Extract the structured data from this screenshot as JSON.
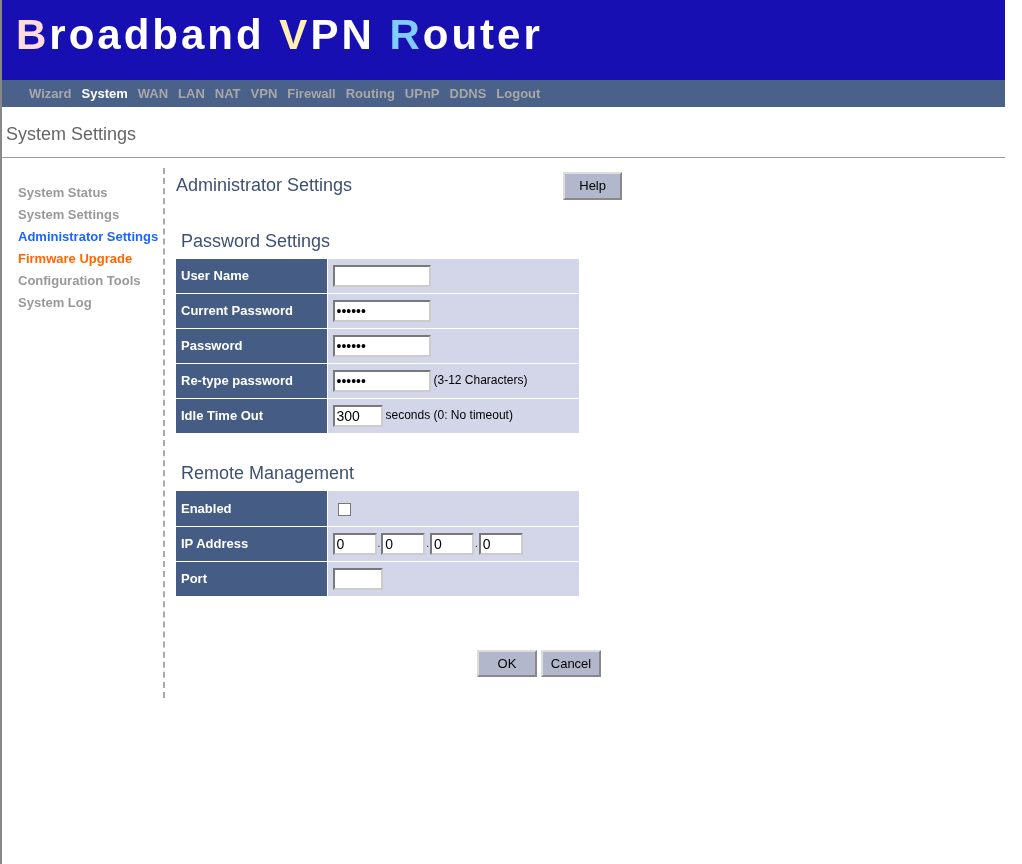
{
  "logo": {
    "parts": [
      {
        "text": "B",
        "color": "#ffdcdc"
      },
      {
        "text": "roadband ",
        "color": "#ffffff"
      },
      {
        "text": "V",
        "color": "#fff0b0"
      },
      {
        "text": "PN ",
        "color": "#ffffff"
      },
      {
        "text": "R",
        "color": "#80ccff"
      },
      {
        "text": "outer",
        "color": "#ffffff"
      }
    ]
  },
  "nav": [
    {
      "label": "Wizard",
      "selected": false
    },
    {
      "label": "System",
      "selected": true
    },
    {
      "label": "WAN",
      "selected": false
    },
    {
      "label": "LAN",
      "selected": false
    },
    {
      "label": "NAT",
      "selected": false
    },
    {
      "label": "VPN",
      "selected": false
    },
    {
      "label": "Firewall",
      "selected": false
    },
    {
      "label": "Routing",
      "selected": false
    },
    {
      "label": "UPnP",
      "selected": false
    },
    {
      "label": "DDNS",
      "selected": false
    },
    {
      "label": "Logout",
      "selected": false
    }
  ],
  "page_title": "System Settings",
  "sidebar": {
    "items": [
      {
        "label": "System Status",
        "color": "#999999"
      },
      {
        "label": "System Settings",
        "color": "#999999"
      },
      {
        "label": "Administrator Settings",
        "color": "#1a66ff"
      },
      {
        "label": "Firmware Upgrade",
        "color": "#ff6600"
      },
      {
        "label": "Configuration Tools",
        "color": "#999999"
      },
      {
        "label": "System Log",
        "color": "#999999"
      }
    ]
  },
  "heading": "Administrator Settings",
  "help_button": "Help",
  "sections": [
    {
      "title": "Password Settings",
      "rows": [
        {
          "label": "User Name",
          "kind": "text"
        },
        {
          "label": "Current Password",
          "kind": "text",
          "value": "••••••"
        },
        {
          "label": "Password",
          "kind": "text",
          "value": "••••••"
        },
        {
          "label": "Re-type password",
          "kind": "text",
          "value": "••••••",
          "note": "(3-12 Characters)"
        },
        {
          "label": "Idle Time Out",
          "kind": "short",
          "value": "300",
          "note": "seconds (0: No timeout)"
        }
      ]
    },
    {
      "title": "Remote Management",
      "rows": [
        {
          "label": "Enabled",
          "kind": "checkbox",
          "checked": false
        },
        {
          "label": "IP Address",
          "kind": "ip",
          "octets": [
            "0",
            "0",
            "0",
            "0"
          ],
          "separator": "."
        },
        {
          "label": "Port",
          "kind": "short"
        }
      ]
    }
  ],
  "buttons": [
    "OK",
    "Cancel"
  ]
}
